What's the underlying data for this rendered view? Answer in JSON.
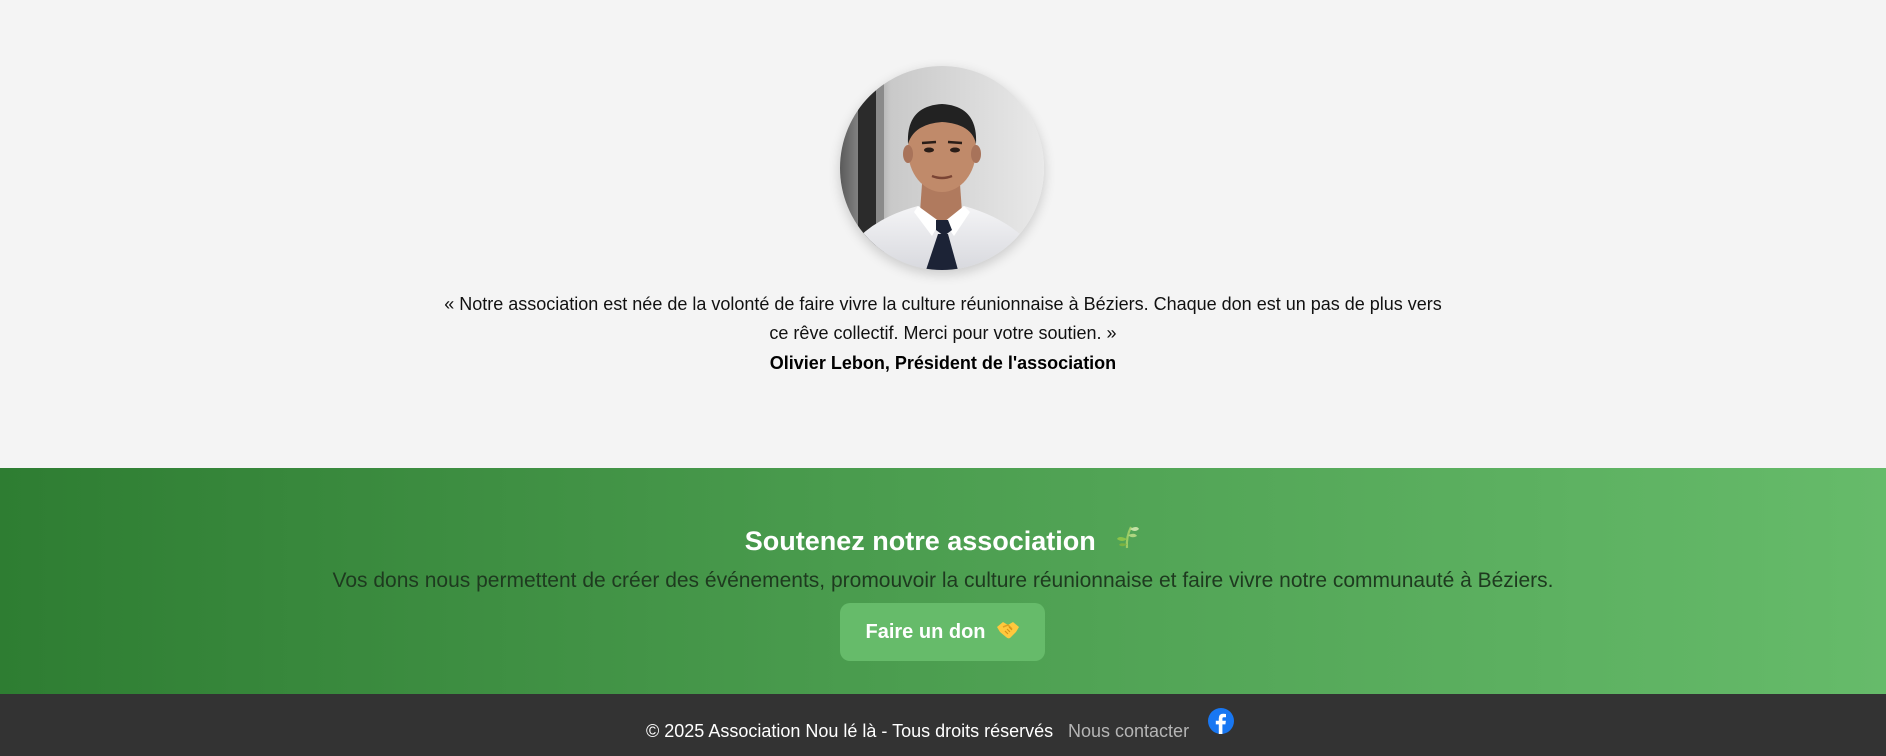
{
  "testimonial": {
    "avatar_alt": "Olivier Lebon",
    "quote_line1": "« Notre association est née de la volonté de faire vivre la culture réunionnaise à Béziers. Chaque don est un pas de plus vers",
    "quote_line2": "ce rêve collectif. Merci pour votre soutien. »",
    "author": "Olivier Lebon, Président de l'association"
  },
  "support": {
    "title": "Soutenez notre association",
    "title_icon": "sprout-icon",
    "text": "Vos dons nous permettent de créer des événements, promouvoir la culture réunionnaise et faire vivre notre communauté à Béziers.",
    "button_label": "Faire un don",
    "button_icon": "handshake-icon"
  },
  "footer": {
    "copyright": "© 2025 Association Nou lé là - Tous droits réservés",
    "contact_label": "Nous contacter",
    "social_icon": "facebook-icon"
  },
  "colors": {
    "page_background": "#f4f4f4",
    "gradient_start": "#2e7d32",
    "gradient_end": "#66bb6a",
    "button_background": "#66bb6a",
    "footer_background": "#333333",
    "facebook_blue": "#1877f2"
  }
}
